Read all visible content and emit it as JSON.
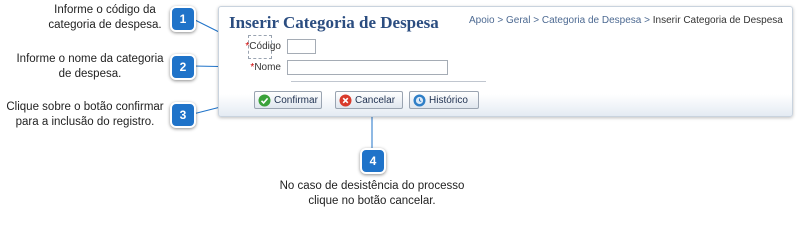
{
  "callouts": [
    {
      "badge": "1",
      "text_line1": "Informe o código da",
      "text_line2": "categoria de despesa."
    },
    {
      "badge": "2",
      "text_line1": "Informe o nome da categoria",
      "text_line2": "de despesa."
    },
    {
      "badge": "3",
      "text_line1": "Clique sobre o botão confirmar",
      "text_line2": "para a inclusão do registro."
    },
    {
      "badge": "4",
      "text_line1": "No caso de desistência do processo",
      "text_line2": "clique no botão cancelar."
    }
  ],
  "panel": {
    "title": "Inserir Categoria de Despesa",
    "breadcrumb": {
      "items": [
        "Apoio",
        "Geral",
        "Categoria de Despesa"
      ],
      "separator": ">",
      "current": "Inserir Categoria de Despesa"
    },
    "fields": [
      {
        "required_mark": "*",
        "label": "Código",
        "value": ""
      },
      {
        "required_mark": "*",
        "label": "Nome",
        "value": ""
      }
    ],
    "buttons": [
      {
        "label": "Confirmar",
        "icon": "check-icon"
      },
      {
        "label": "Cancelar",
        "icon": "cancel-icon"
      },
      {
        "label": "Histórico",
        "icon": "history-icon"
      }
    ]
  },
  "colors": {
    "badge": "#1f73c9",
    "title": "#2b4d80",
    "link": "#4d6a92",
    "confirm": "#3aa23a",
    "cancel": "#d93a2b",
    "history": "#2f7fc7"
  }
}
